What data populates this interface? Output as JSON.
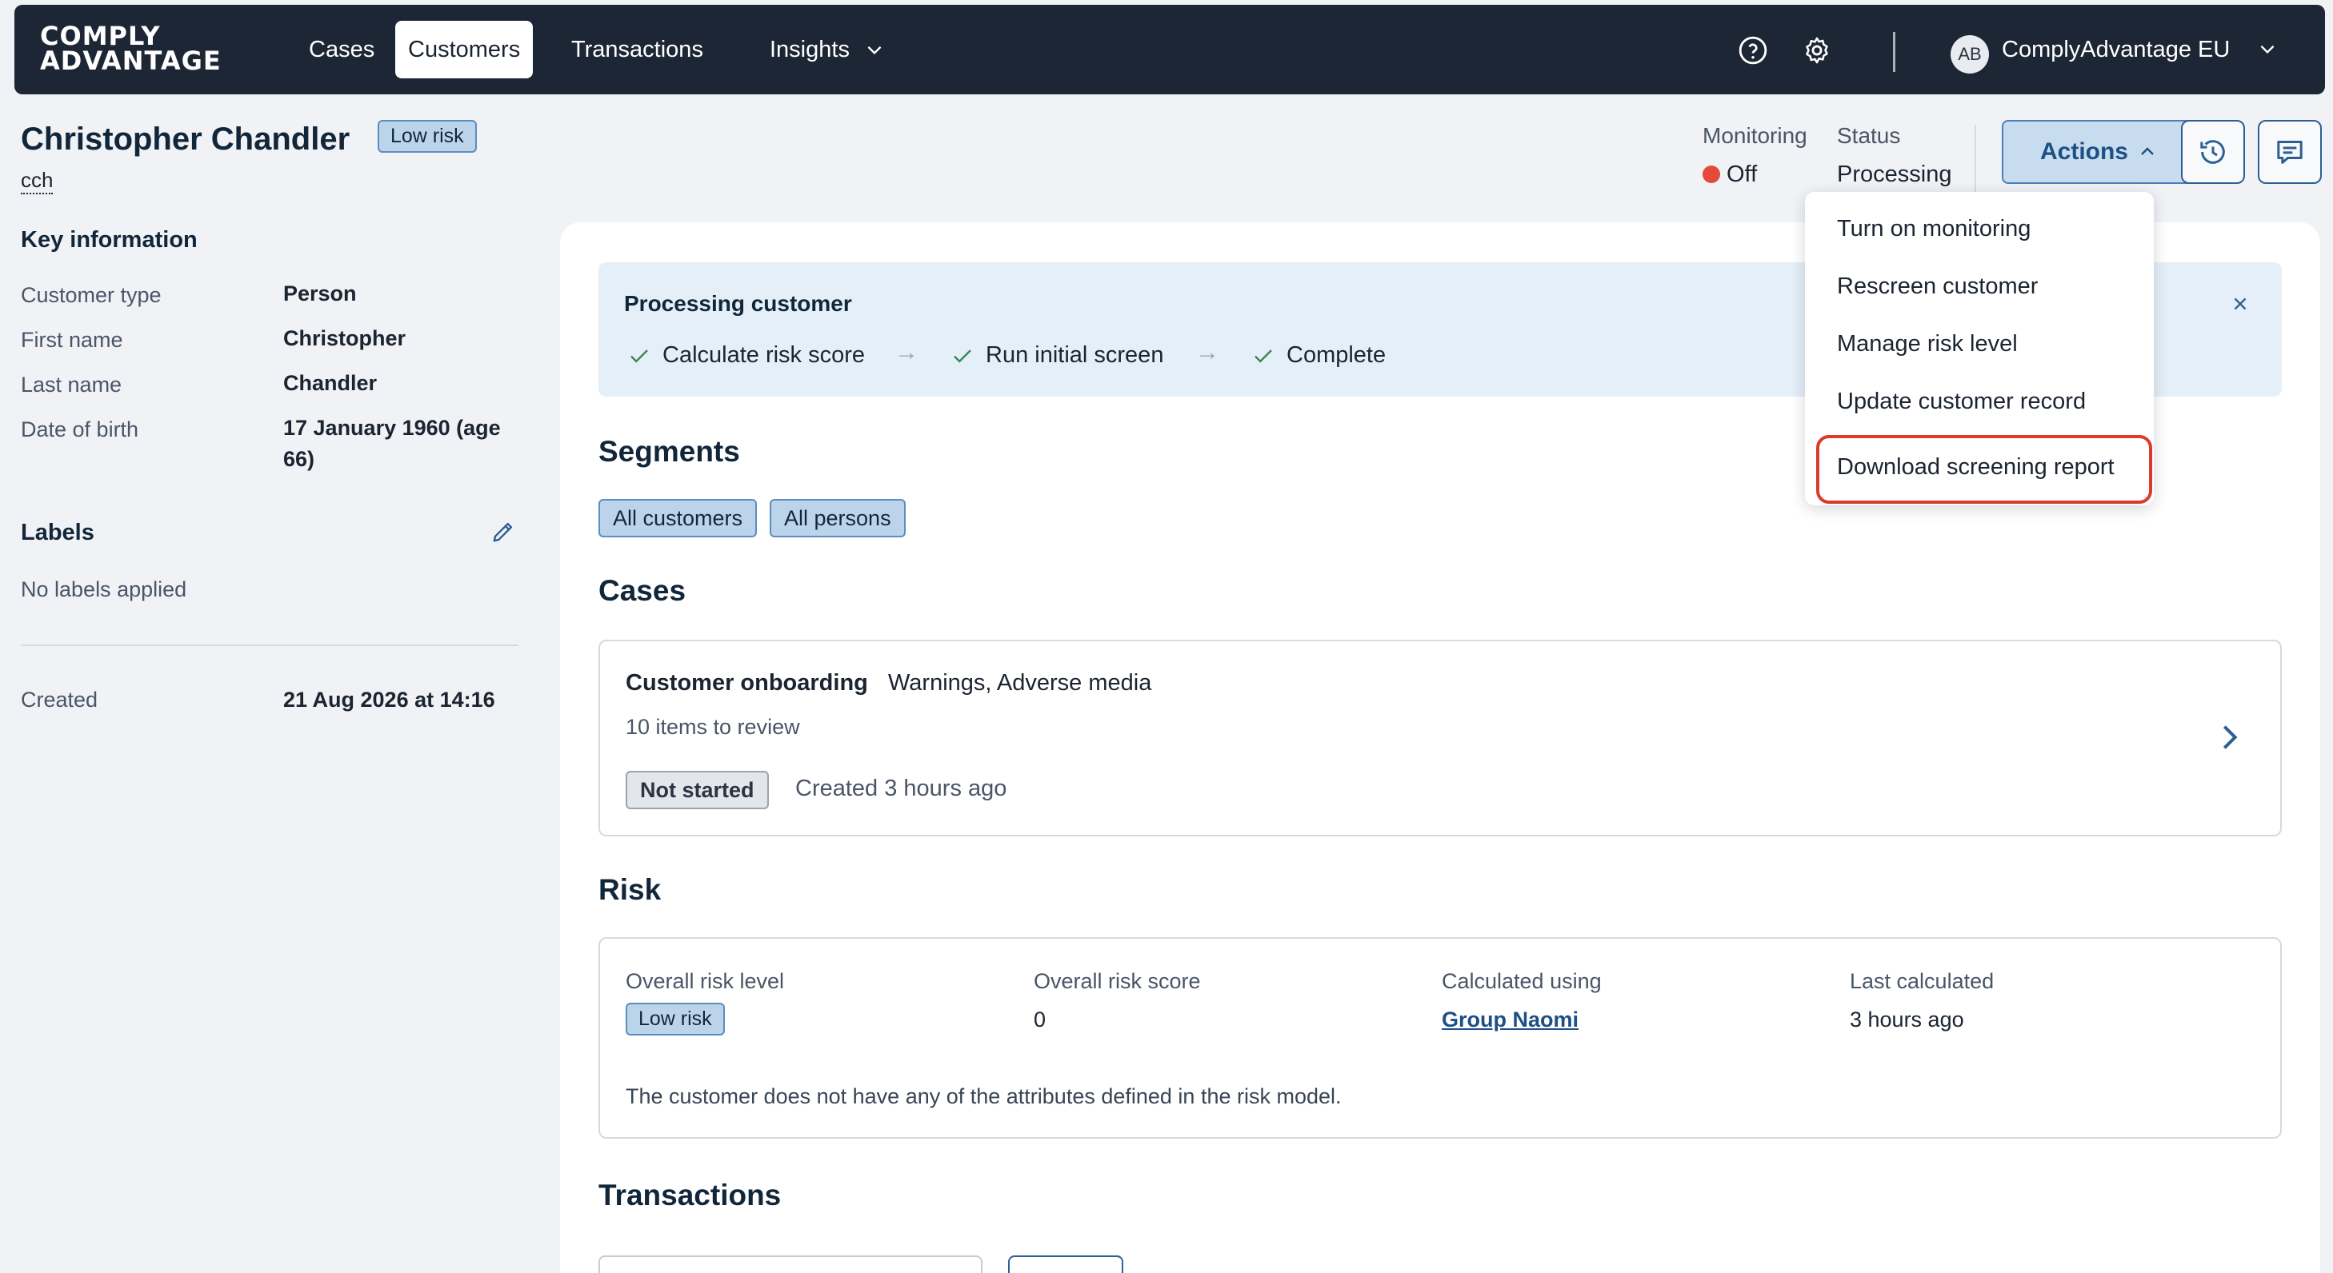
{
  "brand": {
    "line1": "COMPLY",
    "line2": "ADVANTAGE"
  },
  "nav": {
    "cases": "Cases",
    "customers": "Customers",
    "transactions": "Transactions",
    "insights": "Insights"
  },
  "account": {
    "initials": "AB",
    "name": "ComplyAdvantage EU"
  },
  "customer": {
    "name": "Christopher Chandler",
    "risk_badge": "Low risk",
    "id": "cch"
  },
  "key_info": {
    "title": "Key information",
    "rows": [
      {
        "label": "Customer type",
        "value": "Person"
      },
      {
        "label": "First name",
        "value": "Christopher"
      },
      {
        "label": "Last name",
        "value": "Chandler"
      },
      {
        "label": "Date of birth",
        "value_line1": "17 January 1960 (age",
        "value_line2": "66)"
      }
    ]
  },
  "labels": {
    "title": "Labels",
    "empty": "No labels applied"
  },
  "created": {
    "label": "Created",
    "value": "21 Aug 2026 at 14:16"
  },
  "header_status": {
    "monitoring_label": "Monitoring",
    "monitoring_value": "Off",
    "status_label": "Status",
    "status_value": "Processing",
    "actions_label": "Actions",
    "colors": {
      "monitoring_off": "#e5493a",
      "accent": "#1e4f85"
    }
  },
  "processing": {
    "title": "Processing customer",
    "steps": [
      "Calculate risk score",
      "Run initial screen",
      "Complete"
    ],
    "arrow": "→"
  },
  "segments": {
    "title": "Segments",
    "chips": [
      "All customers",
      "All persons"
    ]
  },
  "cases": {
    "title": "Cases",
    "item": {
      "title": "Customer onboarding",
      "tags": "Warnings, Adverse media",
      "count": "10 items to review",
      "status": "Not started",
      "created": "Created 3 hours ago"
    }
  },
  "risk": {
    "title": "Risk",
    "overall_level_label": "Overall risk level",
    "overall_level_value": "Low risk",
    "overall_score_label": "Overall risk score",
    "overall_score_value": "0",
    "calculated_using_label": "Calculated using",
    "calculated_using_value": "Group Naomi",
    "last_calculated_label": "Last calculated",
    "last_calculated_value": "3 hours ago",
    "note": "The customer does not have any of the attributes defined in the risk model."
  },
  "transactions": {
    "title": "Transactions"
  },
  "actions_menu": {
    "items": [
      "Turn on monitoring",
      "Rescreen customer",
      "Manage risk level",
      "Update customer record",
      "Download screening report"
    ],
    "highlight_color": "#dd3a2c"
  }
}
